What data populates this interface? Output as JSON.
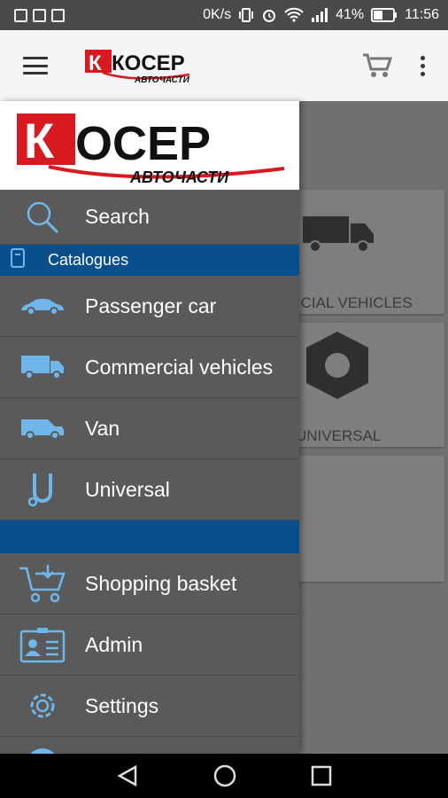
{
  "status_bar": {
    "speed": "0K/s",
    "battery": "41%",
    "time": "11:56"
  },
  "brand": {
    "name": "КОСЕР",
    "tagline": "АВТОЧАСТИ",
    "accent": "#d71920"
  },
  "background_tiles": {
    "commercial": "ERCIAL VEHICLES",
    "universal": "UNIVERSAL"
  },
  "drawer": {
    "search_label": "Search",
    "catalogues_label": "Catalogues",
    "items": [
      {
        "label": "Passenger car",
        "icon": "car-icon"
      },
      {
        "label": "Commercial vehicles",
        "icon": "truck-icon"
      },
      {
        "label": "Van",
        "icon": "van-icon"
      },
      {
        "label": "Universal",
        "icon": "universal-icon"
      }
    ],
    "bottom_items": [
      {
        "label": "Shopping basket",
        "icon": "cart-icon"
      },
      {
        "label": "Admin",
        "icon": "admin-icon"
      },
      {
        "label": "Settings",
        "icon": "gear-icon"
      }
    ]
  },
  "colors": {
    "section": "#0a4f8c",
    "drawer_bg": "#5a5a5a",
    "icon_blue": "#6fb6ea"
  }
}
